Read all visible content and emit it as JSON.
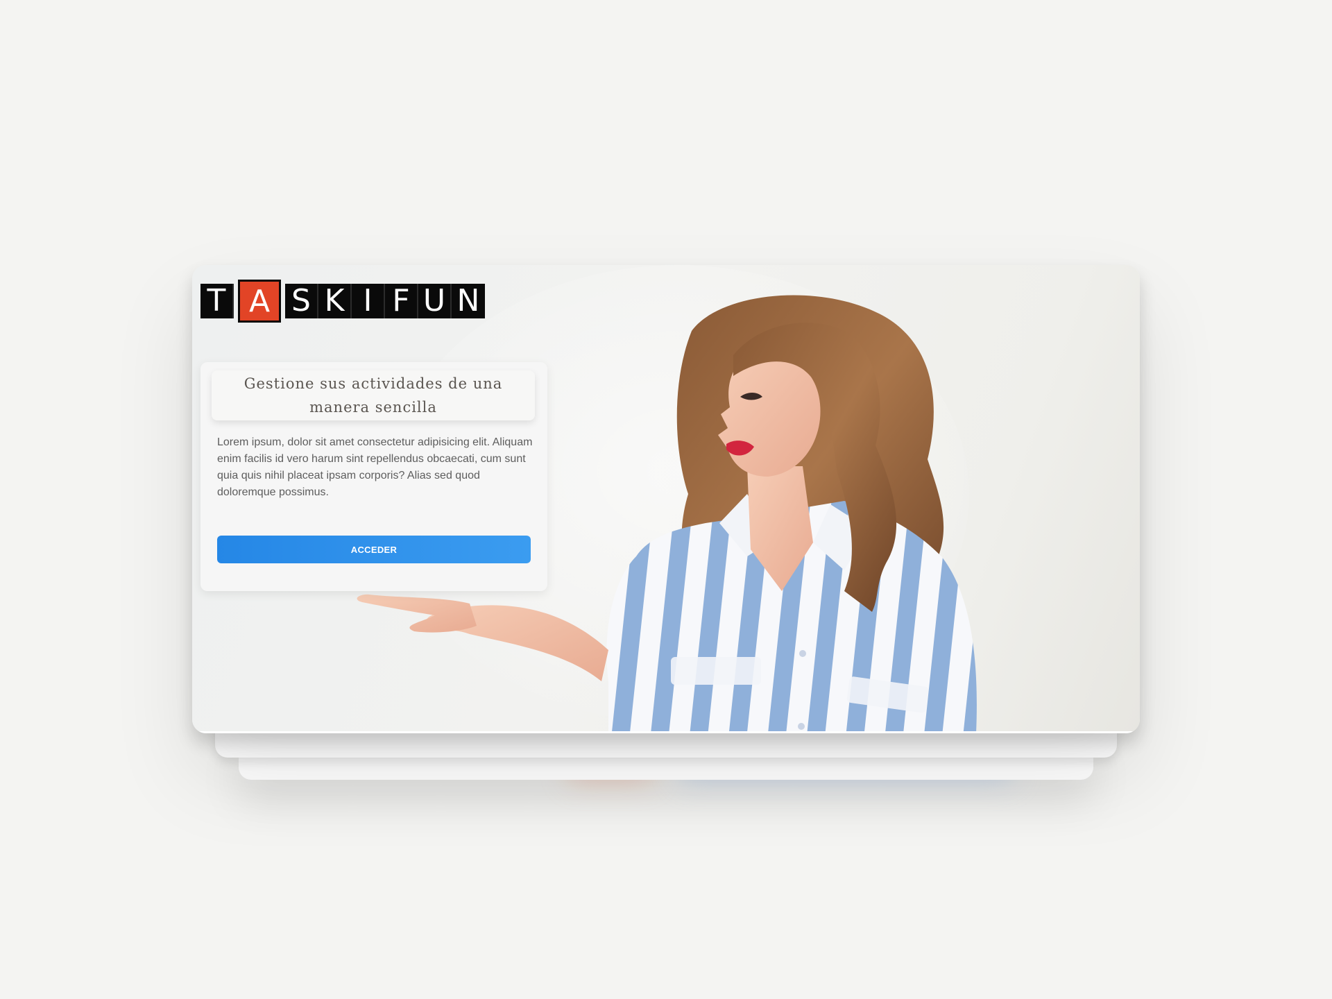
{
  "logo": {
    "letters": [
      "T",
      "A",
      "S",
      "K",
      "I",
      "F",
      "U",
      "N"
    ],
    "alt": "TASKIFUN"
  },
  "hero": {
    "headline": "Gestione sus actividades de una manera sencilla",
    "body": "Lorem ipsum, dolor sit amet consectetur adipisicing elit. Aliquam enim facilis id vero harum sint repellendus obcaecati, cum sunt quia quis nihil placeat ipsam corporis? Alias sed quod doloremque possimus.",
    "cta_label": "ACCEDER",
    "image": "woman-presenting-photo"
  },
  "colors": {
    "accent": "#e24426",
    "button": "#2587e6",
    "background": "#f4f4f2",
    "shirt_stripe": "#8fb0da"
  }
}
